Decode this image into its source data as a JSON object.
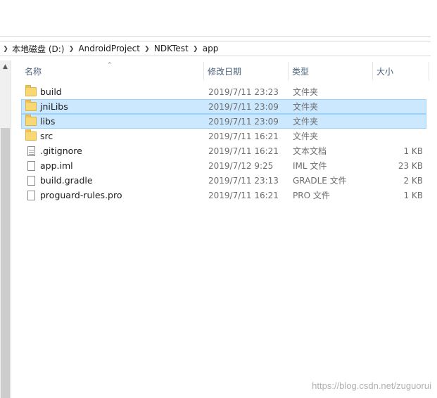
{
  "breadcrumb": {
    "items": [
      "本地磁盘 (D:)",
      "AndroidProject",
      "NDKTest",
      "app"
    ]
  },
  "columns": {
    "name": "名称",
    "date": "修改日期",
    "type": "类型",
    "size": "大小"
  },
  "files": [
    {
      "name": "build",
      "date": "2019/7/11 23:23",
      "type": "文件夹",
      "size": "",
      "icon": "folder-icon",
      "selected": false
    },
    {
      "name": "jniLibs",
      "date": "2019/7/11 23:09",
      "type": "文件夹",
      "size": "",
      "icon": "folder-icon",
      "selected": true
    },
    {
      "name": "libs",
      "date": "2019/7/11 23:09",
      "type": "文件夹",
      "size": "",
      "icon": "folder-icon",
      "selected": true
    },
    {
      "name": "src",
      "date": "2019/7/11 16:21",
      "type": "文件夹",
      "size": "",
      "icon": "folder-icon",
      "selected": false
    },
    {
      "name": ".gitignore",
      "date": "2019/7/11 16:21",
      "type": "文本文档",
      "size": "1 KB",
      "icon": "text-file-icon",
      "selected": false
    },
    {
      "name": "app.iml",
      "date": "2019/7/12 9:25",
      "type": "IML 文件",
      "size": "23 KB",
      "icon": "file-icon",
      "selected": false
    },
    {
      "name": "build.gradle",
      "date": "2019/7/11 23:13",
      "type": "GRADLE 文件",
      "size": "2 KB",
      "icon": "file-icon",
      "selected": false
    },
    {
      "name": "proguard-rules.pro",
      "date": "2019/7/11 16:21",
      "type": "PRO 文件",
      "size": "1 KB",
      "icon": "file-icon",
      "selected": false
    }
  ],
  "watermark": "https://blog.csdn.net/zuguorui",
  "colors": {
    "selection_bg": "#cce8ff",
    "selection_border": "#99d1ff",
    "header_text": "#4c607a",
    "folder": "#f8d775"
  }
}
